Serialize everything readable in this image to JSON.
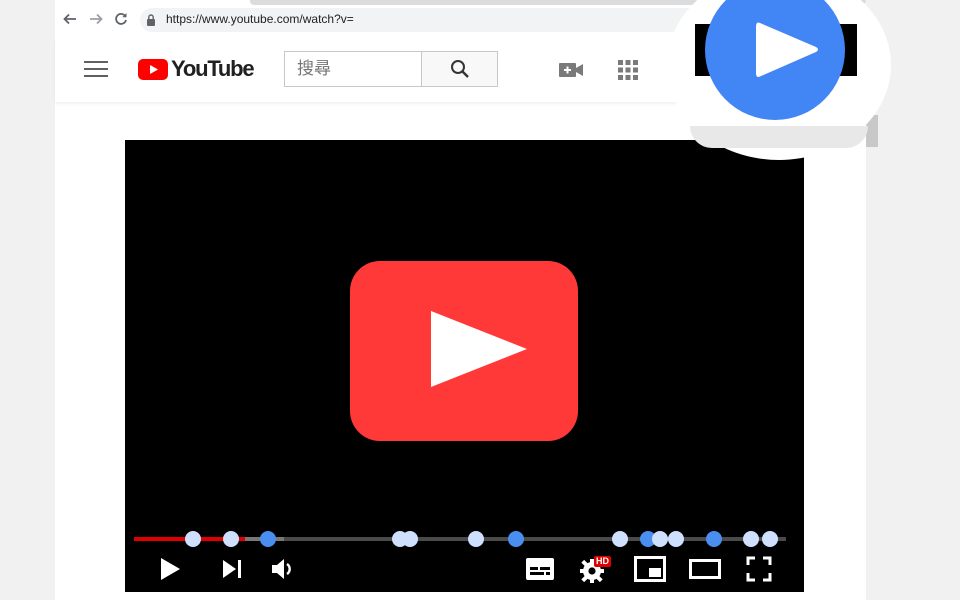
{
  "browser": {
    "url": "https://www.youtube.com/watch?v=",
    "back_icon": "arrow-left-icon",
    "forward_icon": "arrow-right-icon",
    "reload_icon": "reload-icon",
    "lock_icon": "lock-icon"
  },
  "header": {
    "menu_icon": "hamburger-icon",
    "logo_text": "YouTube",
    "search_placeholder": "搜尋",
    "search_icon": "search-icon",
    "create_icon": "video-camera-plus-icon",
    "apps_icon": "apps-grid-icon"
  },
  "player": {
    "big_play_icon": "youtube-play-logo-icon",
    "progress_played_fraction": 0.17,
    "progress_buffered_fraction": 0.23,
    "controls": {
      "play_icon": "play-icon",
      "next_icon": "skip-next-icon",
      "volume_icon": "volume-icon",
      "subtitles_icon": "subtitles-icon",
      "settings_icon": "gear-icon",
      "hd_badge": "HD",
      "miniplayer_icon": "miniplayer-icon",
      "theater_icon": "theater-mode-icon",
      "fullscreen_icon": "fullscreen-icon"
    },
    "marker_count": 14
  },
  "extension_badge": {
    "icon": "blue-play-circle-icon"
  },
  "colors": {
    "youtube_red": "#ff3838",
    "progress_red": "#e00000",
    "marker_blue": "#4a8ff0",
    "marker_light": "#cfe0ff",
    "extension_blue": "#4285f4"
  }
}
